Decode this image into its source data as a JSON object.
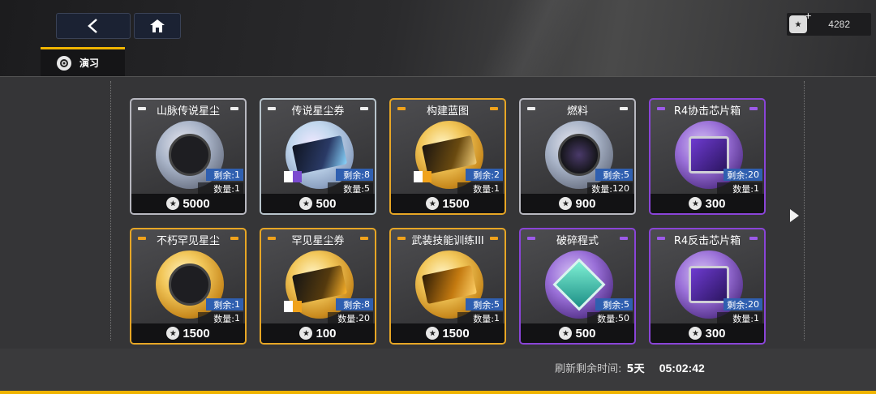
{
  "header": {
    "currency_value": "4282",
    "tab_label": "演习"
  },
  "labels": {
    "remaining_prefix": "剩余: ",
    "quantity_prefix": "数量: "
  },
  "shop": {
    "items": [
      {
        "name": "山脉传说星尘",
        "remaining": "1",
        "quantity": "1",
        "price": "5000",
        "tier": "silver"
      },
      {
        "name": "传说星尘券",
        "remaining": "8",
        "quantity": "5",
        "price": "500",
        "tier": "silverblue"
      },
      {
        "name": "构建蓝图",
        "remaining": "2",
        "quantity": "1",
        "price": "1500",
        "tier": "gold"
      },
      {
        "name": "燃料",
        "remaining": "5",
        "quantity": "120",
        "price": "900",
        "tier": "silver"
      },
      {
        "name": "R4协击芯片箱",
        "remaining": "20",
        "quantity": "1",
        "price": "300",
        "tier": "purple"
      },
      {
        "name": "不朽罕见星尘",
        "remaining": "1",
        "quantity": "1",
        "price": "1500",
        "tier": "gold"
      },
      {
        "name": "罕见星尘券",
        "remaining": "8",
        "quantity": "20",
        "price": "100",
        "tier": "gold"
      },
      {
        "name": "武装技能训练III",
        "remaining": "5",
        "quantity": "1",
        "price": "1500",
        "tier": "gold"
      },
      {
        "name": "破碎程式",
        "remaining": "5",
        "quantity": "50",
        "price": "500",
        "tier": "purple"
      },
      {
        "name": "R4反击芯片箱",
        "remaining": "20",
        "quantity": "1",
        "price": "300",
        "tier": "purple"
      }
    ]
  },
  "footer": {
    "refresh_label": "刷新剩余时间:",
    "refresh_days": "5天",
    "refresh_time": "05:02:42"
  },
  "icons": {
    "back": "back-chevron-icon",
    "home": "home-icon",
    "currency": "star-coin-icon",
    "tab": "exercise-icon",
    "next": "next-arrow-icon"
  },
  "colors": {
    "accent": "#f0b400",
    "gold_tier": "#e7a625",
    "purple_tier": "#8a44d8",
    "remaining_badge": "#2f5fb0"
  }
}
